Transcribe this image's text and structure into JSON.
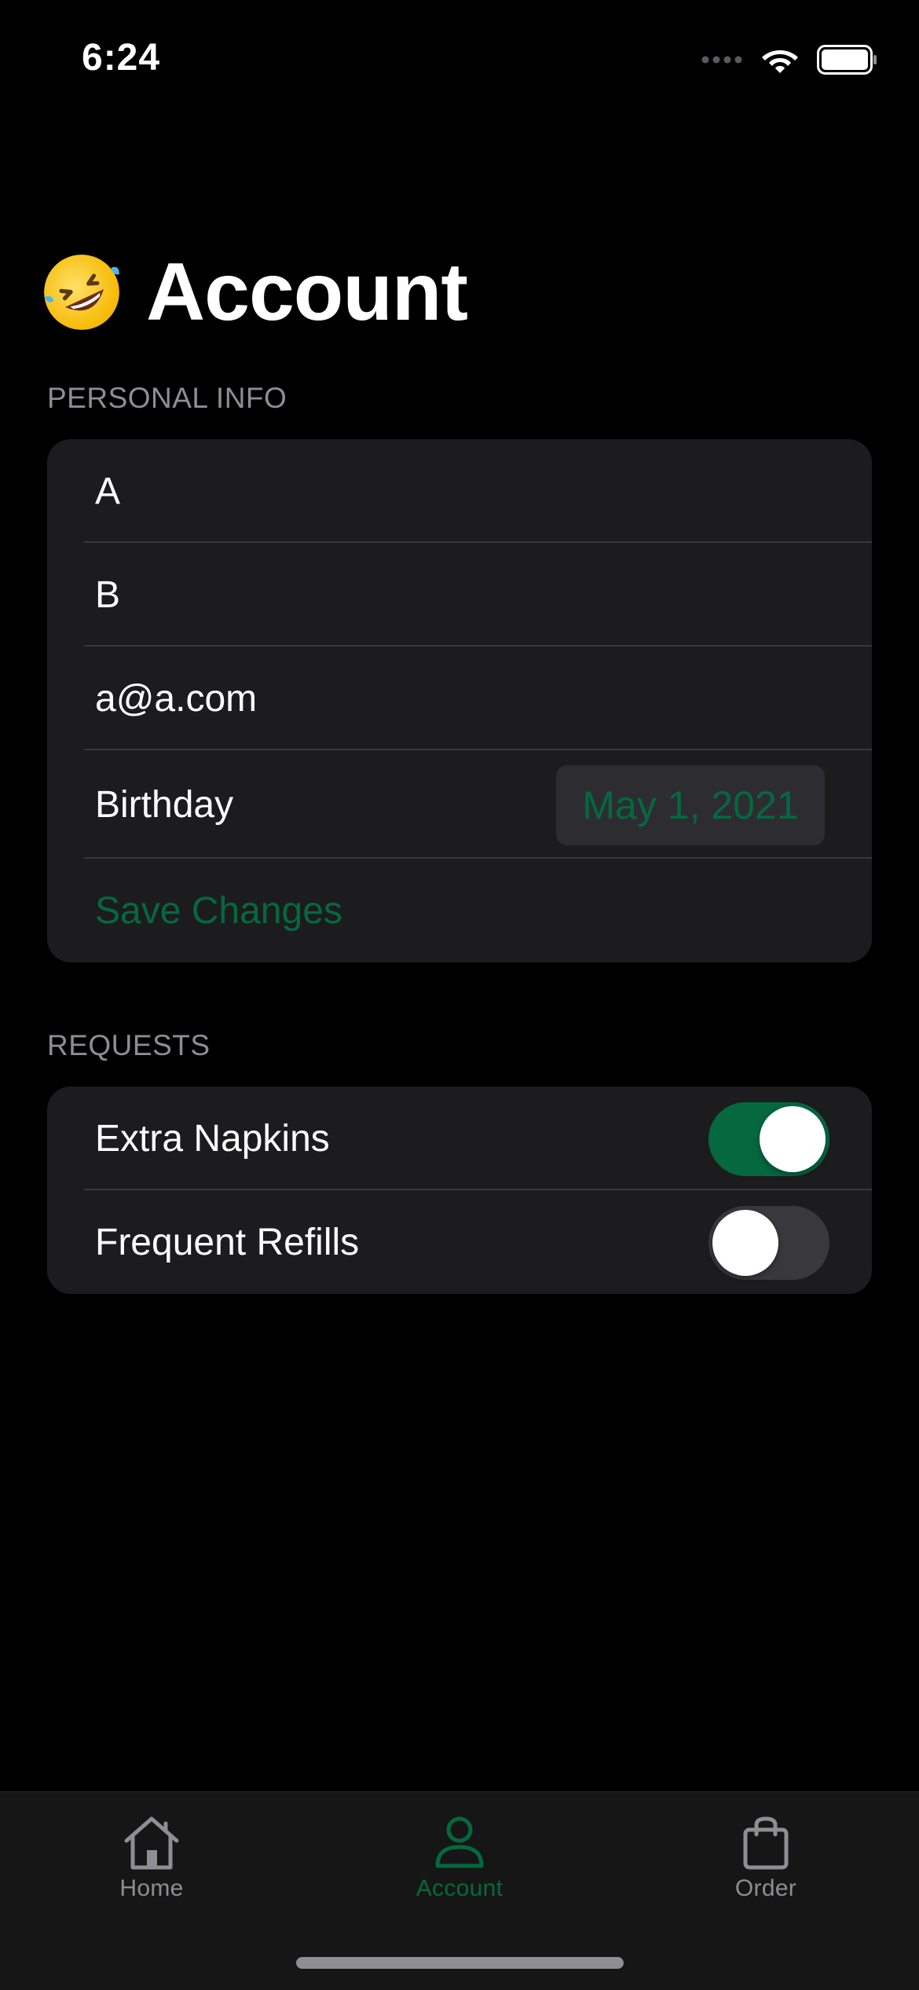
{
  "status_bar": {
    "time": "6:24"
  },
  "header": {
    "title": "Account",
    "emoji_icon": "rolling-on-floor-laughing-emoji"
  },
  "personal_info": {
    "section_title": "PERSONAL INFO",
    "first_name": "A",
    "last_name": "B",
    "email": "a@a.com",
    "birthday_label": "Birthday",
    "birthday_value": "May 1, 2021",
    "save_label": "Save Changes"
  },
  "requests": {
    "section_title": "REQUESTS",
    "items": [
      {
        "label": "Extra Napkins",
        "enabled": true
      },
      {
        "label": "Frequent Refills",
        "enabled": false
      }
    ]
  },
  "tab_bar": {
    "tabs": [
      {
        "label": "Home",
        "icon": "house-icon",
        "selected": false
      },
      {
        "label": "Account",
        "icon": "person-icon",
        "selected": true
      },
      {
        "label": "Order",
        "icon": "bag-icon",
        "selected": false
      }
    ]
  },
  "colors": {
    "accent": "#05683f",
    "background": "#000000",
    "card": "#1c1c1e",
    "secondary_text": "#8d8d93"
  }
}
